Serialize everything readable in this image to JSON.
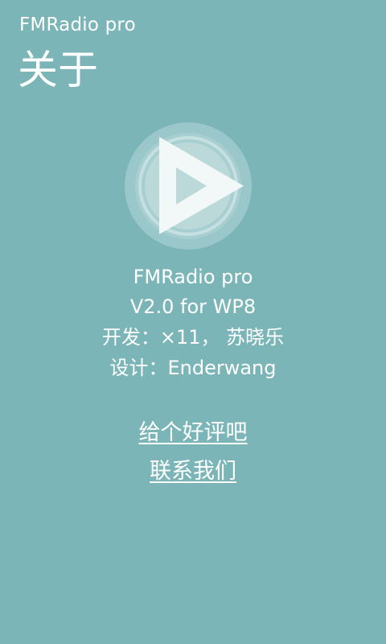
{
  "header": {
    "app_title": "FMRadio pro",
    "page_title": "关于"
  },
  "logo": {
    "icon": "play-icon",
    "ring_color": "#a9cfd1",
    "inner_color": "#bcdadb",
    "triangle_color": "#f2f7f7"
  },
  "info": {
    "app_name": "FMRadio pro",
    "version": "V2.0 for WP8",
    "developer": "开发：×11， 苏晓乐",
    "designer": "设计：Enderwang"
  },
  "links": {
    "rate": "给个好评吧",
    "contact": "联系我们"
  },
  "colors": {
    "background": "#7bb5b8",
    "text": "#ffffff"
  }
}
